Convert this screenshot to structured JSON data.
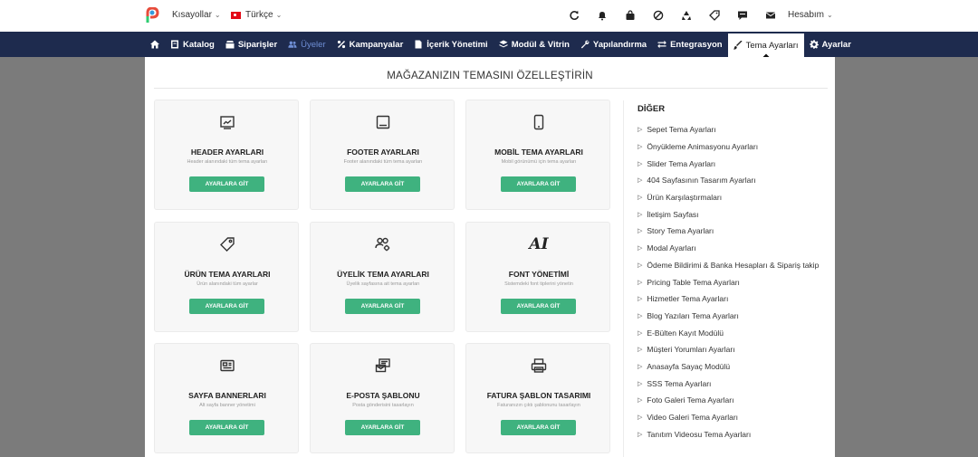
{
  "topbar": {
    "shortcuts_label": "Kısayollar",
    "language_label": "Türkçe",
    "account_label": "Hesabım",
    "icons": [
      "refresh-icon",
      "bell-icon",
      "bag-icon",
      "ban-icon",
      "recycle-icon",
      "tag-icon",
      "message-icon",
      "mail-icon"
    ]
  },
  "nav": {
    "items": [
      {
        "label": "",
        "icon": "home-icon"
      },
      {
        "label": "Katalog",
        "icon": "catalog-icon"
      },
      {
        "label": "Siparişler",
        "icon": "orders-icon"
      },
      {
        "label": "Üyeler",
        "icon": "users-icon"
      },
      {
        "label": "Kampanyalar",
        "icon": "percent-icon"
      },
      {
        "label": "İçerik Yönetimi",
        "icon": "file-icon"
      },
      {
        "label": "Modül & Vitrin",
        "icon": "layers-icon"
      },
      {
        "label": "Yapılandırma",
        "icon": "wrench-icon"
      },
      {
        "label": "Entegrasyon",
        "icon": "exchange-icon"
      },
      {
        "label": "Tema Ayarları",
        "icon": "brush-icon"
      },
      {
        "label": "Ayarlar",
        "icon": "gear-icon"
      }
    ],
    "active_index": 9,
    "muted_index": 3
  },
  "page": {
    "title": "MAĞAZANIZIN TEMASINI ÖZELLEŞTİRİN"
  },
  "cards": [
    {
      "title": "HEADER AYARLARI",
      "desc": "Header alanındaki tüm tema ayarları",
      "button": "AYARLARA GİT",
      "icon": "header-icon"
    },
    {
      "title": "FOOTER AYARLARI",
      "desc": "Footer alanındaki tüm tema ayarları",
      "button": "AYARLARA GİT",
      "icon": "footer-icon"
    },
    {
      "title": "MOBİL TEMA AYARLARI",
      "desc": "Mobil görünümü için tema ayarları",
      "button": "AYARLARA GİT",
      "icon": "mobile-icon"
    },
    {
      "title": "ÜRÜN TEMA AYARLARI",
      "desc": "Ürün alanındaki tüm ayarlar",
      "button": "AYARLARA GİT",
      "icon": "tag-icon"
    },
    {
      "title": "ÜYELİK TEMA AYARLARI",
      "desc": "Üyelik sayfasına ait tema ayarları",
      "button": "AYARLARA GİT",
      "icon": "users-gear-icon"
    },
    {
      "title": "FONT YÖNETİMİ",
      "desc": "Sistemdeki font tiplerini yönetin",
      "button": "AYARLARA GİT",
      "icon": "ai-icon",
      "icon_text": "AI"
    },
    {
      "title": "SAYFA BANNERLARI",
      "desc": "Alt sayfa banner yönetimi",
      "button": "AYARLARA GİT",
      "icon": "banner-icon"
    },
    {
      "title": "E-POSTA ŞABLONU",
      "desc": "Posta gönderisini tasarlayın",
      "button": "AYARLARA GİT",
      "icon": "email-template-icon"
    },
    {
      "title": "FATURA ŞABLON TASARIMI",
      "desc": "Faturanızın çıktı şablonunu tasarlayın",
      "button": "AYARLARA GİT",
      "icon": "printer-icon"
    }
  ],
  "other": {
    "title": "DİĞER",
    "items": [
      "Sepet Tema Ayarları",
      "Önyükleme Animasyonu Ayarları",
      "Slider Tema Ayarları",
      "404 Sayfasının Tasarım Ayarları",
      "Ürün Karşılaştırmaları",
      "İletişim Sayfası",
      "Story Tema Ayarları",
      "Modal Ayarları",
      "Ödeme Bildirimi & Banka Hesapları & Sipariş takip",
      "Pricing Table Tema Ayarları",
      "Hizmetler Tema Ayarları",
      "Blog Yazıları Tema Ayarları",
      "E-Bülten Kayıt Modülü",
      "Müşteri Yorumları Ayarları",
      "Anasayfa Sayaç Modülü",
      "SSS Tema Ayarları",
      "Foto Galeri Tema Ayarları",
      "Video Galeri Tema Ayarları",
      "Tanıtım Videosu Tema Ayarları"
    ]
  },
  "colors": {
    "nav_bg": "#1e2b4e",
    "button_green": "#3fb27f",
    "overlay_gray": "#7b7b7b",
    "flag_red": "#e30a17"
  }
}
